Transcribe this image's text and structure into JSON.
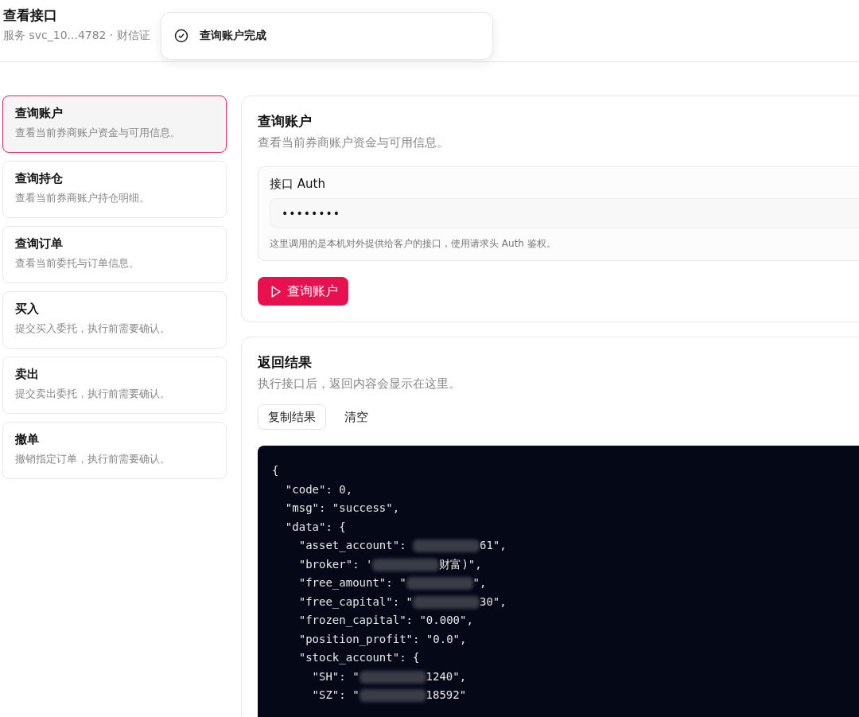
{
  "header": {
    "title": "查看接口",
    "subtitle": "服务 svc_10...4782 · 财信证"
  },
  "toast": {
    "text": "查询账户完成"
  },
  "sidebar": {
    "items": [
      {
        "title": "查询账户",
        "description": "查看当前券商账户资金与可用信息。",
        "selected": true
      },
      {
        "title": "查询持仓",
        "description": "查看当前券商账户持仓明细。",
        "selected": false
      },
      {
        "title": "查询订单",
        "description": "查看当前委托与订单信息。",
        "selected": false
      },
      {
        "title": "买入",
        "description": "提交买入委托，执行前需要确认。",
        "selected": false
      },
      {
        "title": "卖出",
        "description": "提交卖出委托，执行前需要确认。",
        "selected": false
      },
      {
        "title": "撤单",
        "description": "撤销指定订单，执行前需要确认。",
        "selected": false
      }
    ]
  },
  "request_panel": {
    "title": "查询账户",
    "description": "查看当前券商账户资金与可用信息。",
    "auth": {
      "label": "接口 Auth",
      "value": "••••••••",
      "hint": "这里调用的是本机对外提供给客户的接口，使用请求头 Auth 鉴权。"
    },
    "run_button": "查询账户"
  },
  "result_panel": {
    "title": "返回结果",
    "description": "执行接口后，返回内容会显示在这里。",
    "buttons": [
      {
        "label": "复制结果",
        "kind": "outlined"
      },
      {
        "label": "清空",
        "kind": "plain"
      }
    ],
    "code_lines": [
      {
        "segments": [
          {
            "kind": "text",
            "text": "{"
          }
        ]
      },
      {
        "segments": [
          {
            "kind": "text",
            "text": "  \"code\": 0,"
          }
        ]
      },
      {
        "segments": [
          {
            "kind": "text",
            "text": "  \"msg\": \"success\","
          }
        ]
      },
      {
        "segments": [
          {
            "kind": "text",
            "text": "  \"data\": {"
          }
        ]
      },
      {
        "segments": [
          {
            "kind": "text",
            "text": "    \"asset_account\": "
          },
          {
            "kind": "redacted"
          },
          {
            "kind": "text",
            "text": "61\","
          }
        ]
      },
      {
        "segments": [
          {
            "kind": "text",
            "text": "    \"broker\": '"
          },
          {
            "kind": "redacted"
          },
          {
            "kind": "text",
            "text": "财富)\","
          }
        ]
      },
      {
        "segments": [
          {
            "kind": "text",
            "text": "    \"free_amount\": \""
          },
          {
            "kind": "redacted"
          },
          {
            "kind": "text",
            "text": "\","
          }
        ]
      },
      {
        "segments": [
          {
            "kind": "text",
            "text": "    \"free_capital\": \""
          },
          {
            "kind": "redacted"
          },
          {
            "kind": "text",
            "text": "30\","
          }
        ]
      },
      {
        "segments": [
          {
            "kind": "text",
            "text": "    \"frozen_capital\": \"0.000\","
          }
        ]
      },
      {
        "segments": [
          {
            "kind": "text",
            "text": "    \"position_profit\": \"0.0\","
          }
        ]
      },
      {
        "segments": [
          {
            "kind": "text",
            "text": "    \"stock_account\": {"
          }
        ]
      },
      {
        "segments": [
          {
            "kind": "text",
            "text": "      \"SH\": \""
          },
          {
            "kind": "redacted"
          },
          {
            "kind": "text",
            "text": "1240\","
          }
        ]
      },
      {
        "segments": [
          {
            "kind": "text",
            "text": "      \"SZ\": \""
          },
          {
            "kind": "redacted"
          },
          {
            "kind": "text",
            "text": "18592\""
          }
        ]
      }
    ]
  }
}
